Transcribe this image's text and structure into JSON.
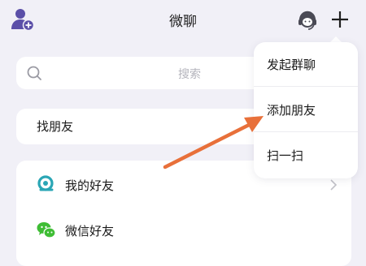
{
  "header": {
    "title": "微聊",
    "add_contact_icon": "person-add-icon",
    "support_icon": "headset-icon",
    "plus_icon": "plus-icon"
  },
  "search": {
    "placeholder": "搜索",
    "icon": "search-icon"
  },
  "find_friends": {
    "title": "找朋友"
  },
  "list": {
    "items": [
      {
        "label": "我的好友",
        "icon": "my-friends-icon"
      },
      {
        "label": "微信好友",
        "icon": "wechat-icon"
      }
    ]
  },
  "popup_menu": {
    "items": [
      {
        "label": "发起群聊"
      },
      {
        "label": "添加朋友"
      },
      {
        "label": "扫一扫"
      }
    ]
  },
  "colors": {
    "background": "#f1f0f7",
    "accent_purple": "#5b4fa8",
    "annotation_arrow": "#e8703a",
    "wechat_green": "#3fbd35",
    "friends_teal": "#2aa6b5"
  }
}
